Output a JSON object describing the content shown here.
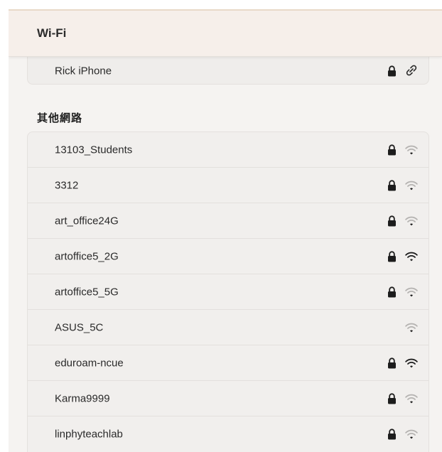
{
  "window": {
    "title": "Wi-Fi"
  },
  "known_network": {
    "name": "Rick iPhone",
    "secured": true,
    "icon": "link-icon"
  },
  "other_networks": {
    "header": "其他網路",
    "items": [
      {
        "name": "13103_Students",
        "secured": true,
        "signal": 0.4
      },
      {
        "name": "3312",
        "secured": true,
        "signal": 0.4
      },
      {
        "name": "art_office24G",
        "secured": true,
        "signal": 0.4
      },
      {
        "name": "artoffice5_2G",
        "secured": true,
        "signal": 1.0
      },
      {
        "name": "artoffice5_5G",
        "secured": true,
        "signal": 0.4
      },
      {
        "name": "ASUS_5C",
        "secured": false,
        "signal": 0.4
      },
      {
        "name": "eduroam-ncue",
        "secured": true,
        "signal": 1.0
      },
      {
        "name": "Karma9999",
        "secured": true,
        "signal": 0.4
      },
      {
        "name": "linphyteachlab",
        "secured": true,
        "signal": 0.4
      }
    ]
  },
  "colors": {
    "icon_dark": "#1c1c1c",
    "icon_dim": "#b5b3b1"
  }
}
